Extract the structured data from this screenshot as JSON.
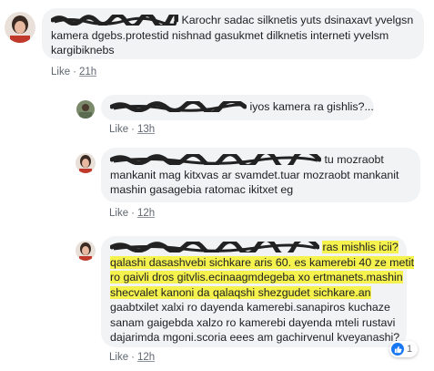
{
  "comments": [
    {
      "text": {
        "line1": "Karochr sadac silknetis yuts dsinaxavt yvelgsn",
        "line2": "kamera dgebs.protestid nishnad gasukmet dilknetis interneti yvelsm",
        "line3": "kargibiknebs"
      },
      "like": "Like",
      "time": "21h"
    },
    {
      "text": {
        "line1": "iyos kamera ra gishlis?..."
      },
      "like": "Like",
      "time": "13h"
    },
    {
      "text": {
        "line1": "tu mozraobt",
        "line2": "mankanit mag kitxvas ar svamdet.tuar mozraobt mankanit",
        "line3": "mashin gasagebia ratomac ikitxet eg"
      },
      "like": "Like",
      "time": "12h"
    },
    {
      "text": {
        "line1": "ras mishlis icii?",
        "line2": "qalashi dasashvebi sichkare aris 60. es kamerebi 40 ze metit",
        "line3": "ro gaivli dros gitvlis.ecinaagmdegeba xo ertmanets.mashin",
        "line4": "shecvalet kanoni da qalaqshi shezgudet sichkare.an",
        "line5": "gaabtxilet xalxi ro dayenda kamerebi.sanapiros kuchaze",
        "line6": "sanam gaigebda xalzo ro kamerebi dayenda mteli rustavi",
        "line7": "dajarimda mgoni.scoria eees am gachirvenul kveyanashi?"
      },
      "like": "Like",
      "time": "12h",
      "reaction_count": "1"
    }
  ],
  "colors": {
    "bubble": "#f2f3f5",
    "highlight": "#f6f24d",
    "meta_text": "#606770",
    "like_blue": "#1877f2"
  },
  "icons": [
    "like-reaction-icon",
    "redaction-scribble-icon"
  ]
}
